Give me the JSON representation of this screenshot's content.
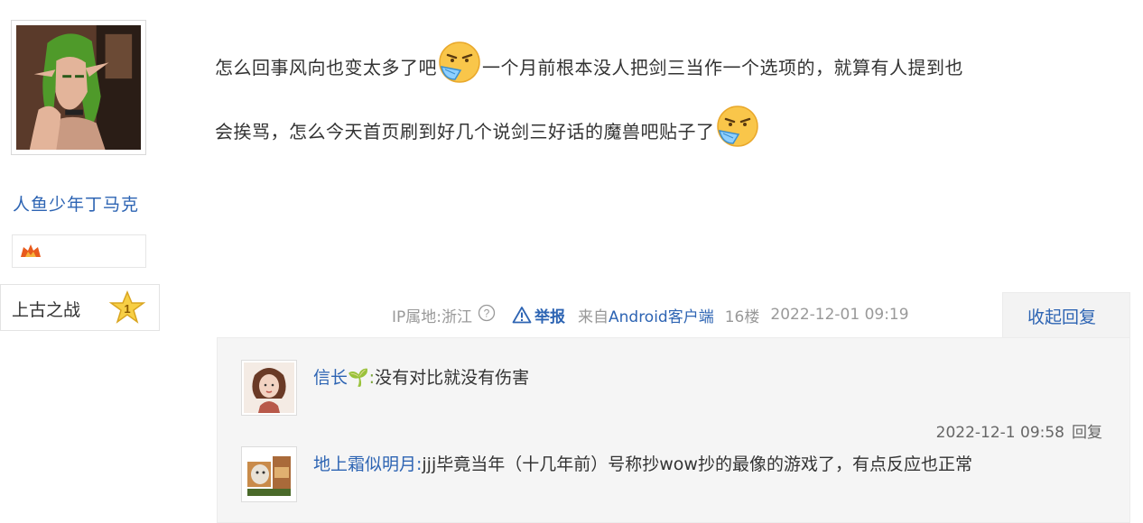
{
  "author": {
    "username": "人鱼少年丁马克",
    "guild_name": "上古之战",
    "guild_level": "1"
  },
  "post": {
    "line1_a": "怎么回事风向也变太多了吧",
    "line1_b": "一个月前根本没人把剑三当作一个选项的，就算有人提到也",
    "line2": "会挨骂，怎么今天首页刷到好几个说剑三好话的魔兽吧贴子了",
    "emoji": "sick-mask-emoji"
  },
  "meta": {
    "ip_location": "IP属地:浙江",
    "help_icon": "?",
    "report_label": "举报",
    "source_prefix": "来自",
    "source_client": "Android客户端",
    "floor": "16楼",
    "timestamp": "2022-12-01 09:19",
    "collapse_label": "收起回复"
  },
  "replies": [
    {
      "user": "信长",
      "user_suffix": "🌱:",
      "text": "没有对比就没有伤害",
      "time": "2022-12-1 09:58",
      "reply_label": "回复"
    },
    {
      "user": "地上霜似明月:",
      "text": "jjj毕竟当年（十几年前）号称抄wow抄的最像的游戏了，有点反应也正常"
    }
  ],
  "colors": {
    "link_blue": "#2d64b3",
    "meta_gray": "#999999",
    "reply_bg": "#f5f5f5"
  }
}
